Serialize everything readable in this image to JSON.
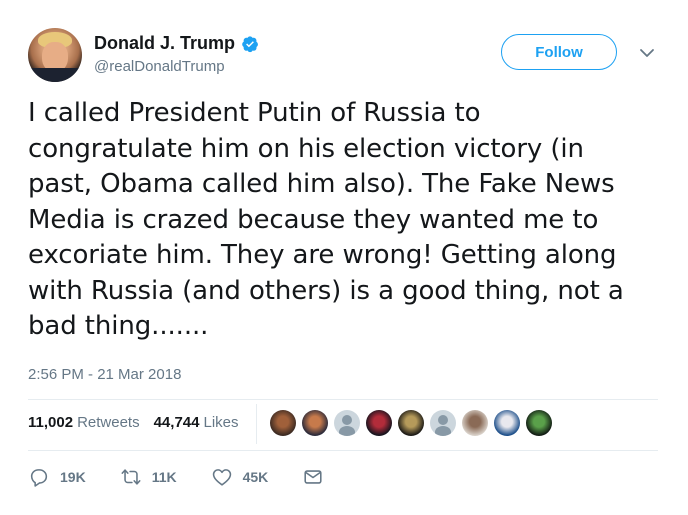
{
  "user": {
    "display_name": "Donald J. Trump",
    "handle": "@realDonaldTrump",
    "verified": true
  },
  "follow_button": {
    "label": "Follow"
  },
  "tweet": {
    "lines": [
      "I called President Putin of Russia to",
      "congratulate him on his election victory (in",
      "past, Obama called him also). The Fake News",
      "Media is crazed because they wanted me to",
      "excoriate him. They are wrong! Getting along",
      "with Russia (and others) is a good thing, not a",
      "bad thing......."
    ],
    "timestamp": "2:56 PM - 21 Mar 2018"
  },
  "stats": {
    "retweets_count": "11,002",
    "retweets_label": "Retweets",
    "likes_count": "44,744",
    "likes_label": "Likes"
  },
  "likers": [
    {
      "icon": "liker-avatar",
      "colors": [
        "#3b2a22",
        "#a0603a"
      ]
    },
    {
      "icon": "liker-avatar",
      "colors": [
        "#2b2a3a",
        "#c77a4b"
      ]
    },
    {
      "icon": "default-avatar-icon",
      "colors": [
        "#ccd6dd",
        "#8899a6"
      ]
    },
    {
      "icon": "liker-avatar",
      "colors": [
        "#16141e",
        "#b22c3a"
      ]
    },
    {
      "icon": "liker-avatar",
      "colors": [
        "#1c1a16",
        "#b59a5a"
      ]
    },
    {
      "icon": "default-avatar-icon",
      "colors": [
        "#ccd6dd",
        "#8899a6"
      ]
    },
    {
      "icon": "liker-avatar",
      "colors": [
        "#d8d0c8",
        "#8a6a56"
      ]
    },
    {
      "icon": "liker-avatar",
      "colors": [
        "#1d4f8a",
        "#e8e8ee"
      ]
    },
    {
      "icon": "liker-avatar",
      "colors": [
        "#121c14",
        "#5aa04a"
      ]
    }
  ],
  "actions": {
    "reply_count": "19K",
    "retweet_count": "11K",
    "like_count": "45K"
  },
  "colors": {
    "accent": "#1da1f2",
    "text": "#14171a",
    "secondary_text": "#657786",
    "divider": "#e6ecf0"
  }
}
